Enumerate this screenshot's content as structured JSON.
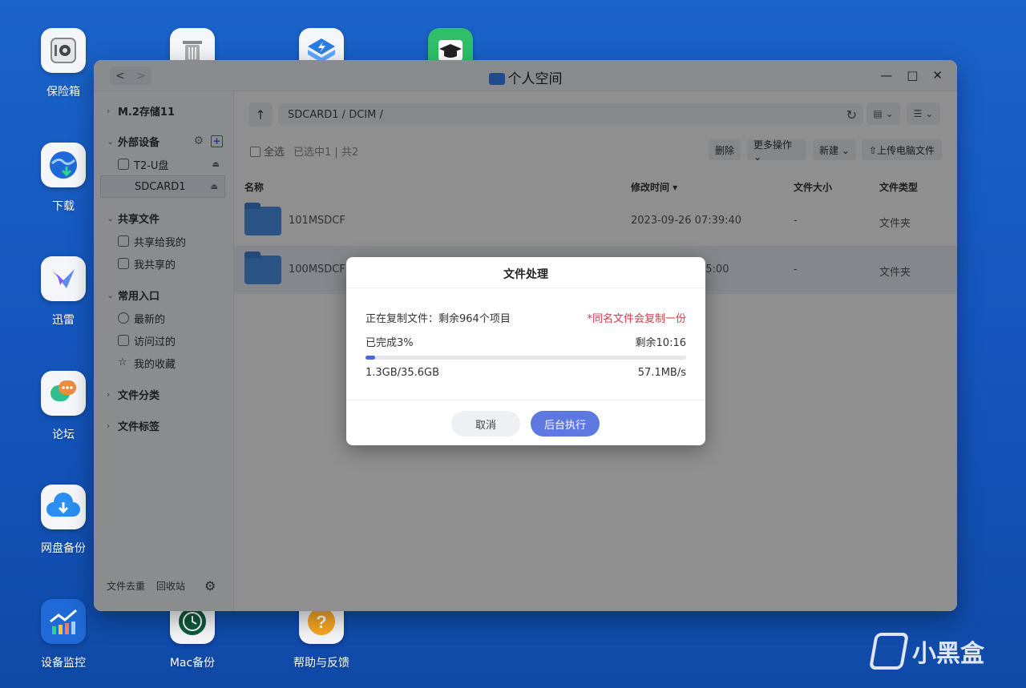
{
  "desktop": {
    "left_icons": [
      {
        "label": "保险箱",
        "icon": "safe-icon"
      },
      {
        "label": "下载",
        "icon": "download-globe-icon"
      },
      {
        "label": "迅雷",
        "icon": "thunder-bird-icon"
      },
      {
        "label": "论坛",
        "icon": "forum-chat-icon"
      },
      {
        "label": "网盘备份",
        "icon": "cloud-download-icon"
      },
      {
        "label": "设备监控",
        "icon": "monitor-chart-icon"
      }
    ],
    "bottom_icons": [
      {
        "label": "Mac备份",
        "icon": "time-machine-icon"
      },
      {
        "label": "帮助与反馈",
        "icon": "help-question-icon"
      }
    ]
  },
  "window": {
    "title": "个人空间",
    "nav_back": "<",
    "nav_forward": ">",
    "controls": {
      "minimize": "—",
      "maximize": "□",
      "close": "✕"
    }
  },
  "sidebar": {
    "storage": "M.2存储11",
    "external_section": "外部设备",
    "devices": [
      "T2-U盘",
      "SDCARD1"
    ],
    "shared_section": "共享文件",
    "shared_items": [
      "共享给我的",
      "我共享的"
    ],
    "common_section": "常用入口",
    "common_items": [
      "最新的",
      "访问过的",
      "我的收藏"
    ],
    "category_section": "文件分类",
    "tag_section": "文件标签",
    "footer": {
      "dedupe": "文件去重",
      "recycle": "回收站"
    }
  },
  "main": {
    "path": "SDCARD1 / DCIM /",
    "select_all": "全选",
    "selection_info": "已选中1 | 共2",
    "actions": [
      "删除",
      "更多操作 ⌄",
      "新建 ⌄",
      "⇧上传电脑文件"
    ],
    "columns": [
      "名称",
      "修改时间 ▾",
      "文件大小",
      "文件类型"
    ],
    "rows": [
      {
        "name": "101MSDCF",
        "modified": "2023-09-26 07:39:40",
        "size": "-",
        "type": "文件夹"
      },
      {
        "name": "100MSDCF",
        "modified": "15:00",
        "size": "-",
        "type": "文件夹"
      }
    ]
  },
  "dialog": {
    "title": "文件处理",
    "status": "正在复制文件：剩余964个项目",
    "note": "*同名文件会复制一份",
    "done": "已完成3%",
    "remaining": "剩余10:16",
    "progress": 0.03,
    "transferred": "1.3GB/35.6GB",
    "speed": "57.1MB/s",
    "cancel": "取消",
    "background": "后台执行"
  },
  "watermark": "小黑盒",
  "colors": {
    "accent": "#5d78e0",
    "warning": "#d33a4a",
    "desktop": "#1456bd"
  }
}
